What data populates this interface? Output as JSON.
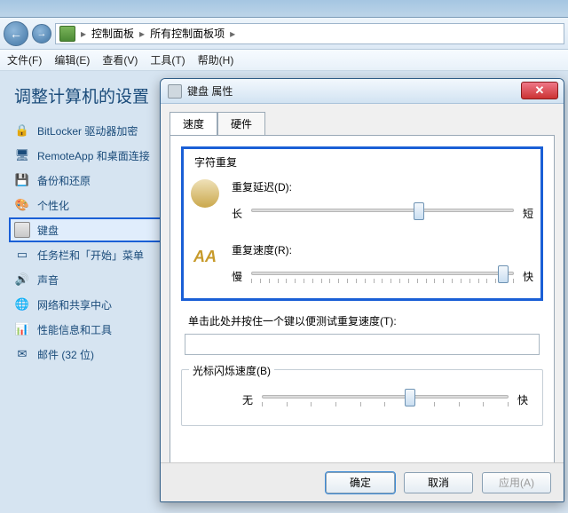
{
  "nav": {
    "crumb1": "控制面板",
    "crumb2": "所有控制面板项",
    "sep": "▸"
  },
  "menu": {
    "file": "文件(F)",
    "edit": "编辑(E)",
    "view": "查看(V)",
    "tools": "工具(T)",
    "help": "帮助(H)"
  },
  "heading": "调整计算机的设置",
  "sidebar": {
    "items": [
      {
        "label": "BitLocker 驱动器加密"
      },
      {
        "label": "RemoteApp 和桌面连接"
      },
      {
        "label": "备份和还原"
      },
      {
        "label": "个性化"
      },
      {
        "label": "键盘"
      },
      {
        "label": "任务栏和「开始」菜单"
      },
      {
        "label": "声音"
      },
      {
        "label": "网络和共享中心"
      },
      {
        "label": "性能信息和工具"
      },
      {
        "label": "邮件 (32 位)"
      }
    ]
  },
  "dialog": {
    "title": "键盘 属性",
    "tabs": {
      "speed": "速度",
      "hardware": "硬件"
    },
    "group_repeat": "字符重复",
    "delay": {
      "label": "重复延迟(D):",
      "left": "长",
      "right": "短",
      "pos": 64
    },
    "rate": {
      "label": "重复速度(R):",
      "left": "慢",
      "right": "快",
      "pos": 96
    },
    "test_label": "单击此处并按住一个键以便测试重复速度(T):",
    "test_value": "",
    "group_cursor": "光标闪烁速度(B)",
    "cursor": {
      "left": "无",
      "right": "快",
      "pos": 60
    },
    "buttons": {
      "ok": "确定",
      "cancel": "取消",
      "apply": "应用(A)"
    }
  }
}
